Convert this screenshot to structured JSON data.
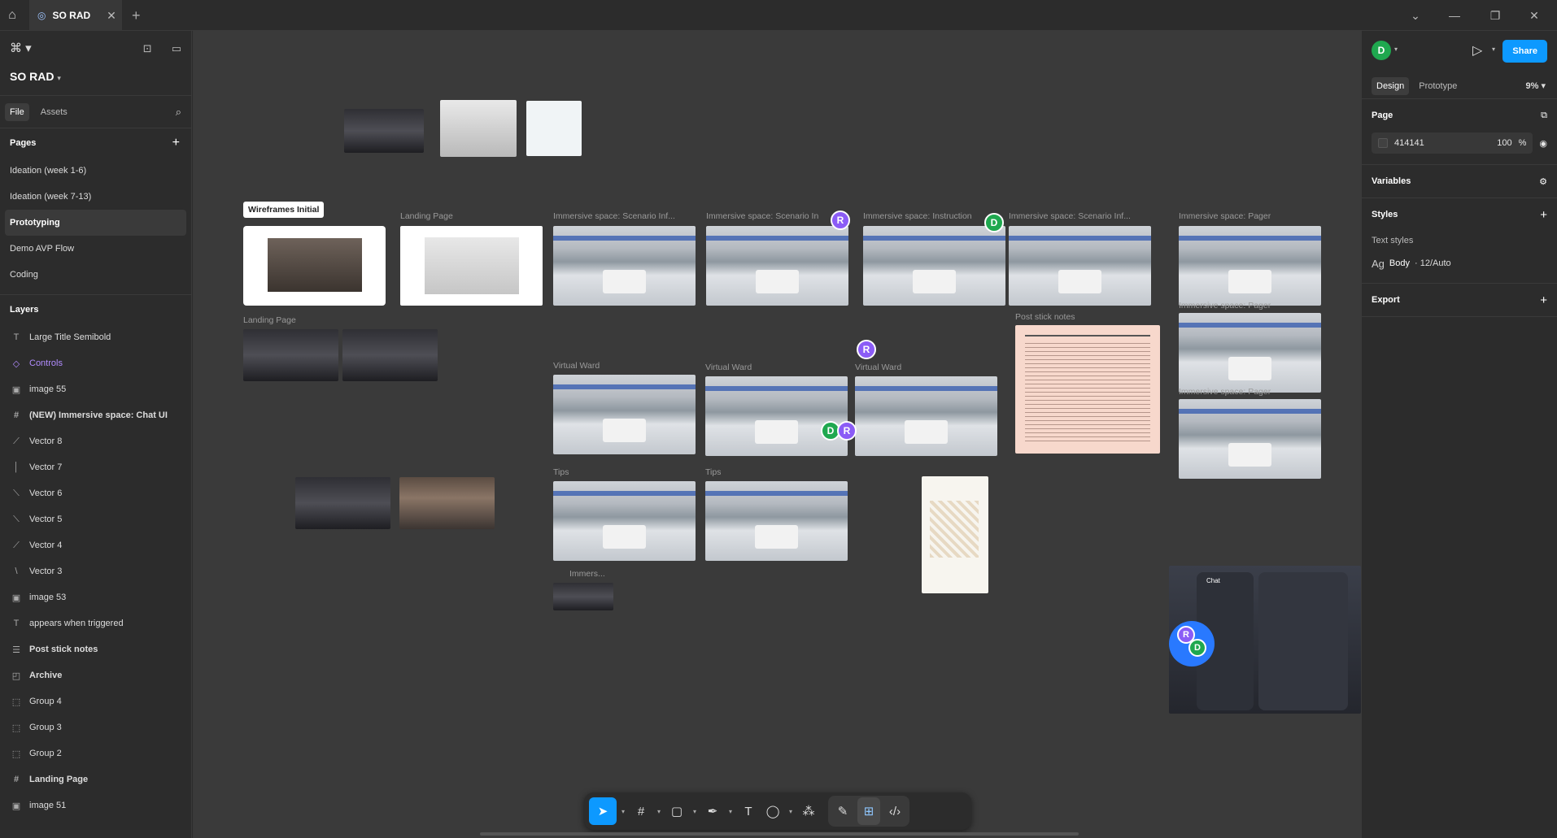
{
  "titlebar": {
    "tab_title": "SO RAD"
  },
  "left": {
    "file_name": "SO RAD",
    "tabs": [
      "File",
      "Assets"
    ],
    "pages_title": "Pages",
    "pages": [
      "Ideation (week 1-6)",
      "Ideation (week 7-13)",
      "Prototyping",
      "Demo AVP Flow",
      "Coding"
    ],
    "layers_title": "Layers",
    "layers": [
      {
        "icon": "T",
        "label": "Large Title Semibold"
      },
      {
        "icon": "◇",
        "label": "Controls"
      },
      {
        "icon": "▣",
        "label": "image 55"
      },
      {
        "icon": "#",
        "label": "(NEW) Immersive space: Chat UI"
      },
      {
        "icon": "⟋",
        "label": "Vector 8"
      },
      {
        "icon": "│",
        "label": "Vector 7"
      },
      {
        "icon": "⟍",
        "label": "Vector 6"
      },
      {
        "icon": "⟍",
        "label": "Vector 5"
      },
      {
        "icon": "⟋",
        "label": "Vector 4"
      },
      {
        "icon": "\\",
        "label": "Vector 3"
      },
      {
        "icon": "▣",
        "label": "image 53"
      },
      {
        "icon": "T",
        "label": "appears when triggered"
      },
      {
        "icon": "☰",
        "label": "Post stick notes"
      },
      {
        "icon": "◰",
        "label": "Archive"
      },
      {
        "icon": "⬚",
        "label": "Group 4"
      },
      {
        "icon": "⬚",
        "label": "Group 3"
      },
      {
        "icon": "⬚",
        "label": "Group 2"
      },
      {
        "icon": "#",
        "label": "Landing Page"
      },
      {
        "icon": "▣",
        "label": "image 51"
      }
    ]
  },
  "canvas": {
    "labels": {
      "wireframes_initial": "Wireframes Initial",
      "landing_page_1": "Landing Page",
      "landing_page_2": "Landing Page",
      "scenario_1": "Immersive space: Scenario Inf...",
      "scenario_2": "Immersive space: Scenario In",
      "instruction": "Immersive space: Instruction",
      "scenario_3": "Immersive space: Scenario Inf...",
      "pager_1": "Immersive space: Pager",
      "pager_2": "Immersive space: Pager",
      "pager_3": "Immersive space: Pager",
      "virtual_ward_1": "Virtual Ward",
      "virtual_ward_2": "Virtual Ward",
      "virtual_ward_3": "Virtual Ward",
      "tips_1": "Tips",
      "tips_2": "Tips",
      "post_stick_notes": "Post stick notes",
      "immers": "Immers..."
    },
    "avatars": {
      "r": "R",
      "d": "D"
    },
    "chat_title": "Chat"
  },
  "right": {
    "user_initial": "D",
    "share_label": "Share",
    "tabs": [
      "Design",
      "Prototype"
    ],
    "zoom": "9%",
    "page_title": "Page",
    "page_color": "414141",
    "page_opacity": "100",
    "page_opacity_unit": "%",
    "variables_title": "Variables",
    "styles_title": "Styles",
    "text_styles_title": "Text styles",
    "text_style_prefix": "Ag",
    "text_style_name": "Body",
    "text_style_meta": " · 12/Auto",
    "export_title": "Export"
  }
}
